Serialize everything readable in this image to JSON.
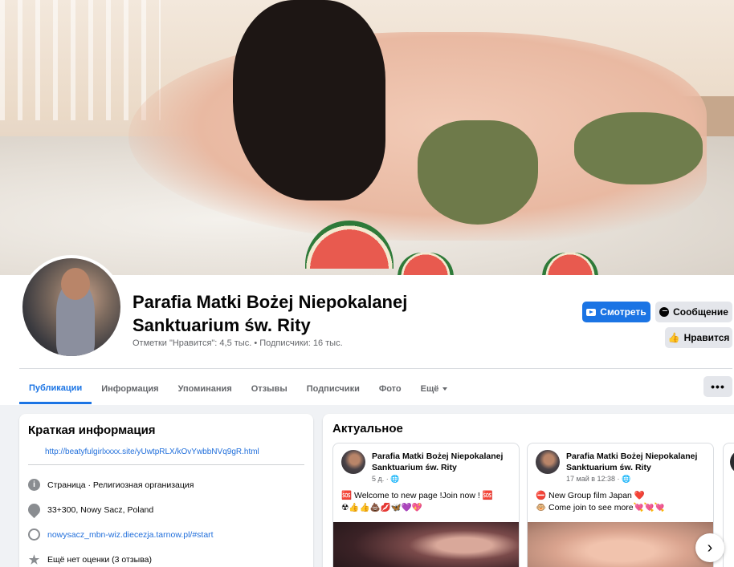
{
  "page": {
    "title_line1": "Parafia Matki Bożej Niepokalanej",
    "title_line2": "Sanktuarium św. Rity",
    "stats": "Отметки \"Нравится\": 4,5 тыс. • Подписчики: 16 тыс."
  },
  "actions": {
    "watch": "Смотреть",
    "message": "Сообщение",
    "like": "Нравится",
    "more": "•••"
  },
  "tabs": [
    {
      "label": "Публикации",
      "active": true
    },
    {
      "label": "Информация"
    },
    {
      "label": "Упоминания"
    },
    {
      "label": "Отзывы"
    },
    {
      "label": "Подписчики"
    },
    {
      "label": "Фото"
    },
    {
      "label": "Ещё"
    }
  ],
  "intro": {
    "title": "Краткая информация",
    "bio_link": "http://beatyfulgirlxxxx.site/yUwtpRLX/kOvYwbbNVq9gR.html",
    "category_label": "Страница",
    "category_value": " · Религиозная организация",
    "address": "33+300, Nowy Sacz, Poland",
    "website": "nowysacz_mbn-wiz.diecezja.tarnow.pl/#start",
    "rating": "Ещё нет оценки (3 отзыва)",
    "info_icon": "i",
    "star_icon": "★"
  },
  "featured": {
    "title": "Актуальное",
    "cards": [
      {
        "name_line1": "Parafia Matki Bożej Niepokalanej",
        "name_line2": "Sanktuarium św. Rity",
        "time": "5 д. · 🌐",
        "text_line1": "🆘 Welcome to new page !Join now ! 🆘",
        "text_line2": "☢👍👍💩💋🦋💜💖"
      },
      {
        "name_line1": "Parafia Matki Bożej Niepokalanej",
        "name_line2": "Sanktuarium św. Rity",
        "time": "17 май в 12:38 · 🌐",
        "text_line1": "⛔ New Group film Japan ❤️",
        "text_line2": "🐵 Come join to see more💘💘💘"
      }
    ],
    "next_icon": "›"
  }
}
